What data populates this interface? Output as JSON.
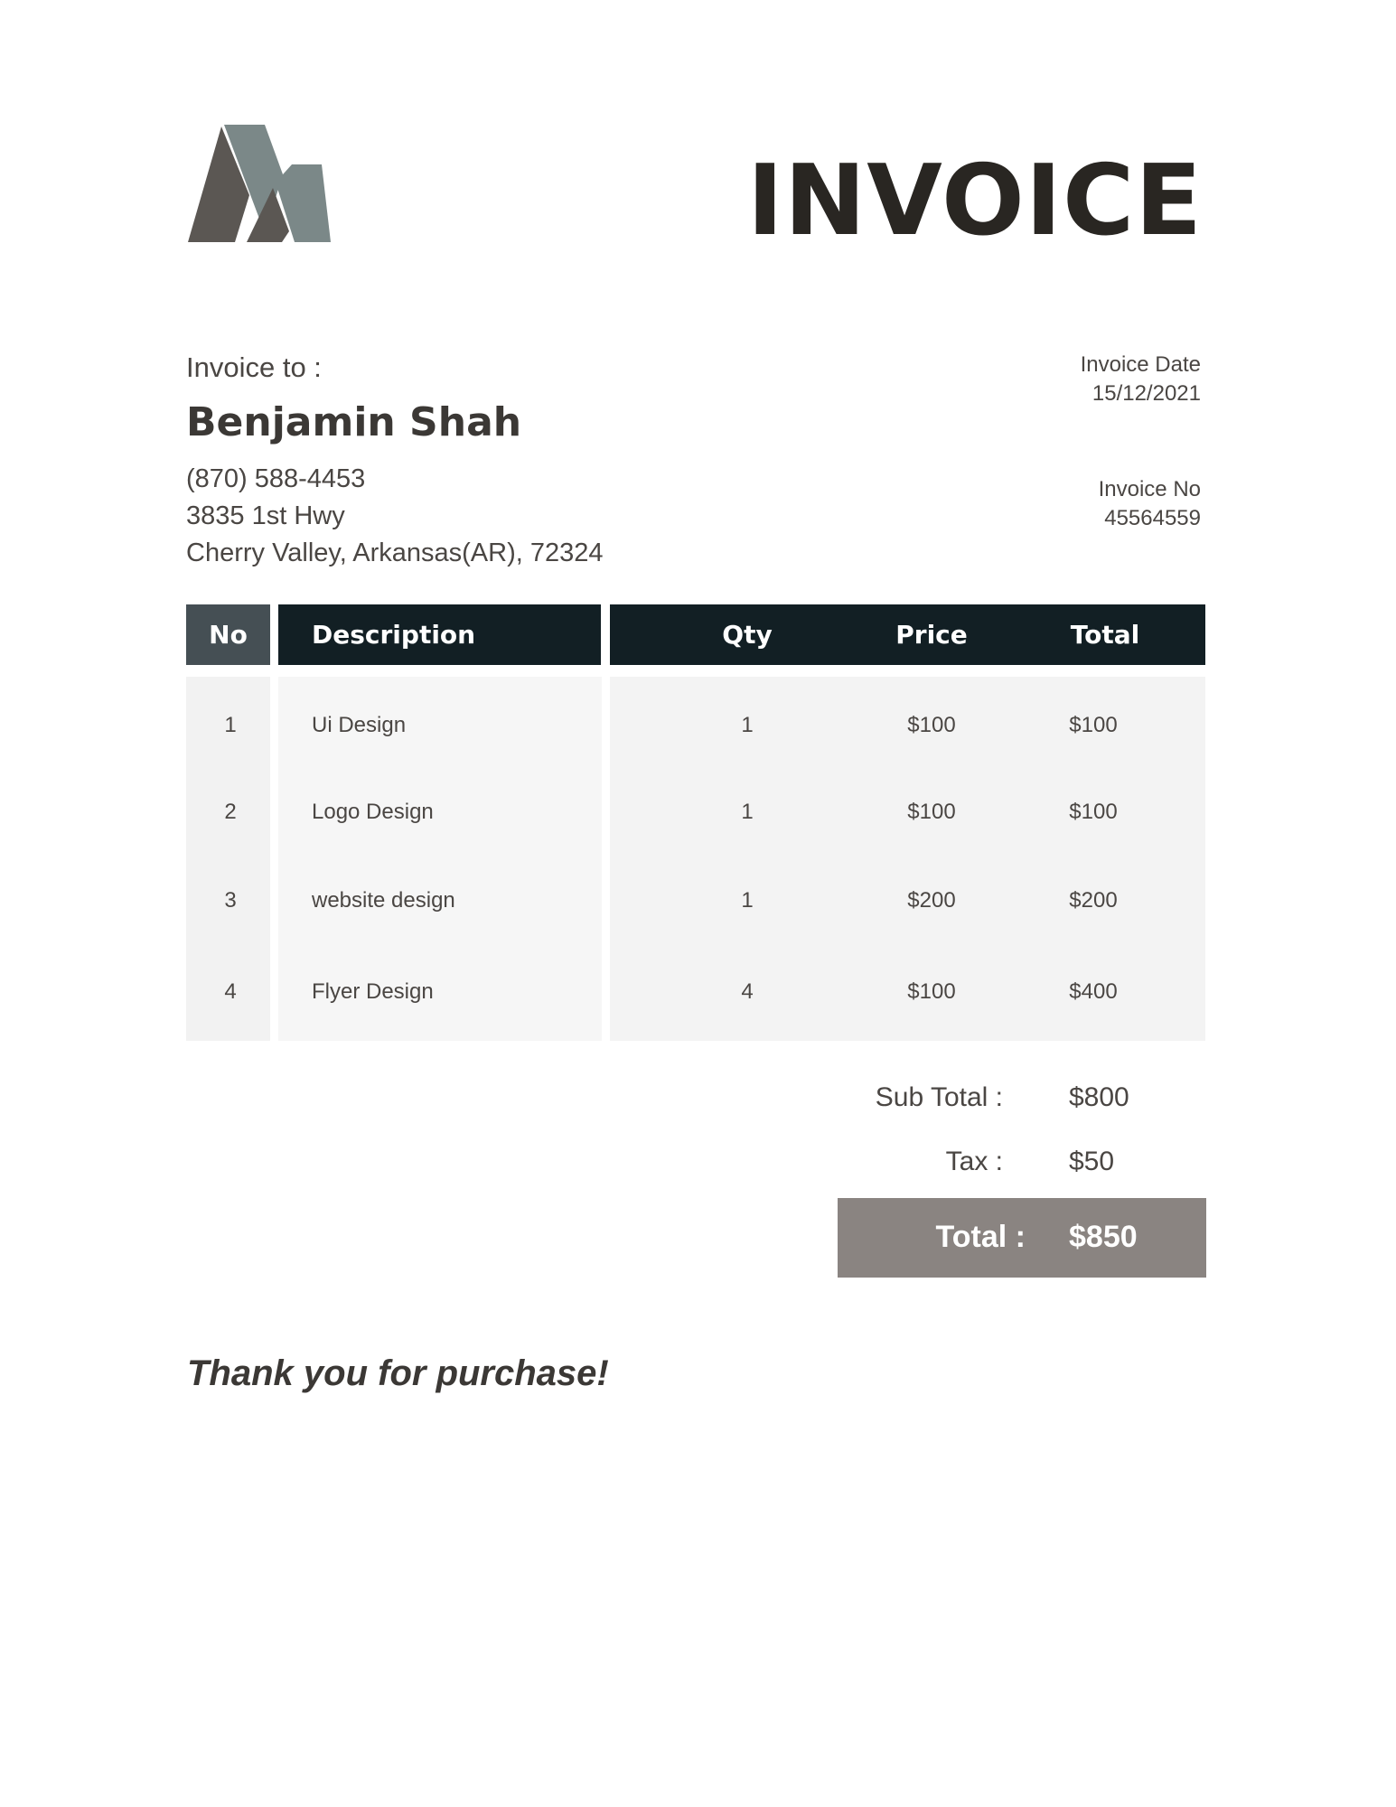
{
  "header": {
    "title": "INVOICE",
    "logo_icon": "mountain-logo"
  },
  "client": {
    "label": "Invoice to :",
    "name": "Benjamin Shah",
    "phone": "(870) 588-4453",
    "address_line1": "3835 1st Hwy",
    "address_line2": "Cherry Valley, Arkansas(AR), 72324"
  },
  "meta": {
    "date_label": "Invoice Date",
    "date": "15/12/2021",
    "number_label": "Invoice No",
    "number": "45564559"
  },
  "table": {
    "headers": {
      "no": "No",
      "description": "Description",
      "qty": "Qty",
      "price": "Price",
      "total": "Total"
    },
    "rows": [
      {
        "no": "1",
        "description": "Ui Design",
        "qty": "1",
        "price": "$100",
        "total": "$100"
      },
      {
        "no": "2",
        "description": "Logo Design",
        "qty": "1",
        "price": "$100",
        "total": "$100"
      },
      {
        "no": "3",
        "description": "website design",
        "qty": "1",
        "price": "$200",
        "total": "$200"
      },
      {
        "no": "4",
        "description": "Flyer Design",
        "qty": "4",
        "price": "$100",
        "total": "$400"
      }
    ]
  },
  "summary": {
    "subtotal_label": "Sub Total :",
    "subtotal": "$800",
    "tax_label": "Tax :",
    "tax": "$50",
    "total_label": "Total :",
    "total": "$850"
  },
  "footer": {
    "thanks": "Thank you for purchase!"
  },
  "colors": {
    "header_dark": "#121f24",
    "header_no": "#454f54",
    "total_box": "#8a8481",
    "logo_dark": "#5b5753",
    "logo_light": "#7b8888"
  }
}
